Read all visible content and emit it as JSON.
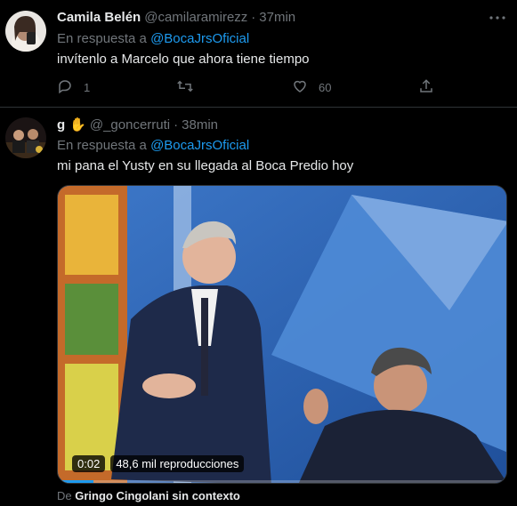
{
  "tweets": [
    {
      "display_name": "Camila Belén",
      "handle": "@camilaramirezz",
      "separator": "·",
      "time": "37min",
      "reply_prefix": "En respuesta a",
      "reply_to": "@BocaJrsOficial",
      "text": "invítenlo a Marcelo que ahora tiene tiempo",
      "replies": "1",
      "retweets": "",
      "likes": "60"
    },
    {
      "display_name": "g",
      "name_emoji": "✋",
      "handle": "@_goncerruti",
      "separator": "·",
      "time": "38min",
      "reply_prefix": "En respuesta a",
      "reply_to": "@BocaJrsOficial",
      "text": "mi pana el Yusty en su llegada al Boca Predio hoy",
      "video": {
        "elapsed": "0:02",
        "views": "48,6 mil reproducciones",
        "progress_fraction": 0.08
      },
      "source_prefix": "De",
      "source_name": "Gringo Cingolani sin contexto"
    }
  ],
  "icons": {
    "more": "more-dots-icon",
    "reply": "reply-icon",
    "retweet": "retweet-icon",
    "like": "heart-icon",
    "share": "share-icon"
  },
  "colors": {
    "background": "#000000",
    "link": "#1d9bf0",
    "muted": "#71767b",
    "text": "#e7e9ea"
  }
}
